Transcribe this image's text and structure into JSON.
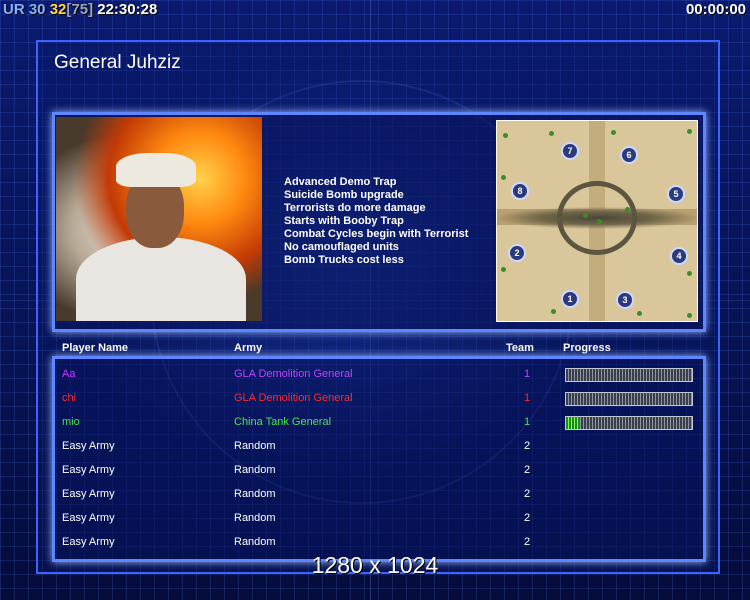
{
  "hud": {
    "ur": "UR",
    "value_a": "30",
    "value_b": "32",
    "value_c": "[75]",
    "clock": "22:30:28",
    "timer": "00:00:00"
  },
  "general": {
    "name": "General Juhziz",
    "bonuses": [
      "Advanced Demo Trap",
      "Suicide Bomb upgrade",
      "Terrorists do more damage",
      "Starts with Booby Trap",
      "Combat Cycles begin with Terrorist",
      "No camouflaged units",
      "Bomb Trucks cost less"
    ]
  },
  "minimap": {
    "spawn_labels": [
      "1",
      "2",
      "3",
      "4",
      "5",
      "6",
      "7",
      "8"
    ]
  },
  "table": {
    "headers": {
      "name": "Player Name",
      "army": "Army",
      "team": "Team",
      "progress": "Progress"
    },
    "rows": [
      {
        "name": "Aa",
        "army": "GLA Demolition General",
        "team": "1",
        "progress": 0.0,
        "color": "#c040ff"
      },
      {
        "name": "chi",
        "army": "GLA Demolition General",
        "team": "1",
        "progress": 0.0,
        "color": "#ff2b2b"
      },
      {
        "name": "mio",
        "army": "China Tank General",
        "team": "1",
        "progress": 0.11,
        "color": "#4fe04f"
      },
      {
        "name": "Easy Army",
        "army": "Random",
        "team": "2",
        "progress": null,
        "color": "#ffffff"
      },
      {
        "name": "Easy Army",
        "army": "Random",
        "team": "2",
        "progress": null,
        "color": "#ffffff"
      },
      {
        "name": "Easy Army",
        "army": "Random",
        "team": "2",
        "progress": null,
        "color": "#ffffff"
      },
      {
        "name": "Easy Army",
        "army": "Random",
        "team": "2",
        "progress": null,
        "color": "#ffffff"
      },
      {
        "name": "Easy Army",
        "army": "Random",
        "team": "2",
        "progress": null,
        "color": "#ffffff"
      }
    ]
  },
  "footer": {
    "resolution": "1280 x 1024"
  }
}
